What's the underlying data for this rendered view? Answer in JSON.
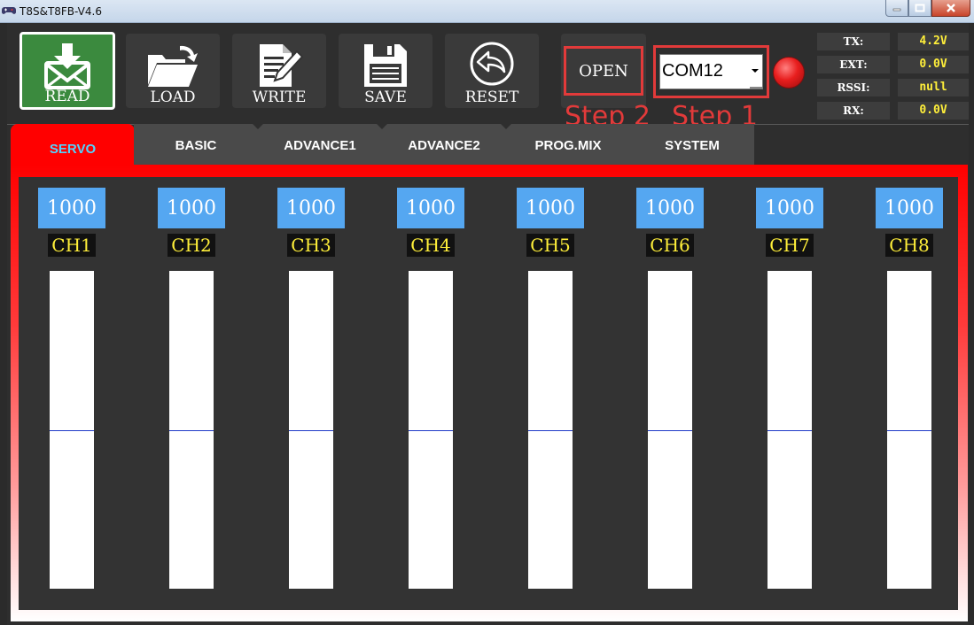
{
  "window": {
    "title": "T8S&T8FB-V4.6",
    "controls": [
      "minimize",
      "maximize",
      "close"
    ]
  },
  "toolbar": {
    "read_label": "READ",
    "load_label": "LOAD",
    "write_label": "WRITE",
    "save_label": "SAVE",
    "reset_label": "RESET",
    "open_label": "OPEN"
  },
  "connection": {
    "port_value": "COM12",
    "status_led": "red",
    "step1": "Step 1",
    "step2": "Step 2"
  },
  "status": [
    {
      "label": "TX:",
      "value": "4.2V"
    },
    {
      "label": "EXT:",
      "value": "0.0V"
    },
    {
      "label": "RSSI:",
      "value": "null"
    },
    {
      "label": "RX:",
      "value": "0.0V"
    }
  ],
  "tabs": [
    {
      "label": "SERVO",
      "active": true
    },
    {
      "label": "BASIC",
      "active": false
    },
    {
      "label": "ADVANCE1",
      "active": false
    },
    {
      "label": "ADVANCE2",
      "active": false
    },
    {
      "label": "PROG.MIX",
      "active": false
    },
    {
      "label": "SYSTEM",
      "active": false
    }
  ],
  "channels": [
    {
      "name": "CH1",
      "value": "1000",
      "level": 0.5
    },
    {
      "name": "CH2",
      "value": "1000",
      "level": 0.5
    },
    {
      "name": "CH3",
      "value": "1000",
      "level": 0.5
    },
    {
      "name": "CH4",
      "value": "1000",
      "level": 0.5
    },
    {
      "name": "CH5",
      "value": "1000",
      "level": 0.5
    },
    {
      "name": "CH6",
      "value": "1000",
      "level": 0.5
    },
    {
      "name": "CH7",
      "value": "1000",
      "level": 0.5
    },
    {
      "name": "CH8",
      "value": "1000",
      "level": 0.5
    }
  ],
  "colors": {
    "read_button": "#3b8a3e",
    "active_tab": "#ff0000",
    "active_tab_text": "#52d3ff",
    "channel_value_bg": "#55a7f1",
    "channel_label_text": "#ffef3a",
    "status_value_text": "#ffef3a",
    "annotation": "#e23a3a"
  }
}
